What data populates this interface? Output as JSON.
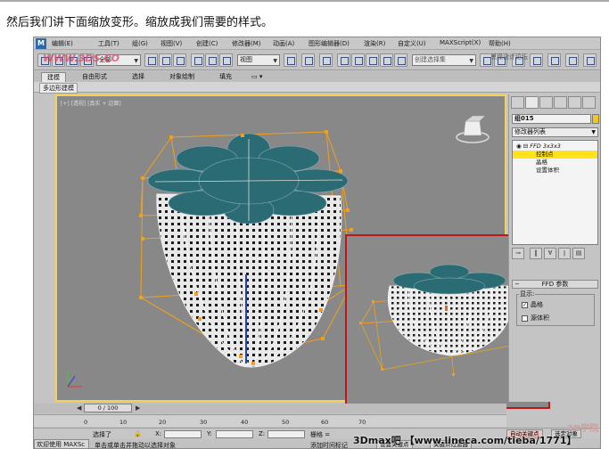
{
  "article": {
    "caption": "然后我们讲下面缩放变形。缩放成我们需要的样式。"
  },
  "menubar": {
    "items": [
      "编辑(E)",
      "工具(T)",
      "组(G)",
      "视图(V)",
      "创建(C)",
      "修改器(M)",
      "动画(A)",
      "图形编辑器(D)",
      "渲染(R)",
      "自定义(U)",
      "MAXScript(X)",
      "帮助(H)"
    ]
  },
  "toolbar": {
    "selection_filter": "全部",
    "reference_coord": "视图",
    "named_selection_placeholder": "创建选择集"
  },
  "watermarks": {
    "top_left": "WWW.3DS.CO",
    "top_right": "思缘设计论坛",
    "bottom": "3Dmax吧 【www.lineca.com/tieba/1771】",
    "brand": "3D学院"
  },
  "ribbon": {
    "tabs": [
      "建模",
      "自由形式",
      "选择",
      "对象绘制",
      "填充"
    ],
    "active_tab": "建模",
    "sub_label": "多边形建模"
  },
  "viewport": {
    "label": "[+] [透视] [真实 + 边面]"
  },
  "command_panel": {
    "object_name": "组015",
    "object_color": "#f3c61a",
    "modifier_list_label": "修改器列表",
    "stack": [
      {
        "label": "FFD 3x3x3",
        "level": 0,
        "selected": false
      },
      {
        "label": "控制点",
        "level": 1,
        "selected": true
      },
      {
        "label": "晶格",
        "level": 1,
        "selected": false
      },
      {
        "label": "设置体积",
        "level": 1,
        "selected": false
      }
    ],
    "rollout_title": "FFD 参数",
    "display_group": "显示:",
    "checkboxes": [
      {
        "label": "晶格",
        "checked": true
      },
      {
        "label": "源体积",
        "checked": false
      }
    ]
  },
  "timeline": {
    "thumb_label": "0 / 100",
    "ticks": [
      "0",
      "10",
      "20",
      "30",
      "40",
      "50",
      "60",
      "70"
    ]
  },
  "status": {
    "selected": "选择了",
    "x_label": "X:",
    "y_label": "Y:",
    "z_label": "Z:",
    "grid": "栅格 =",
    "auto_key": "自动关键点",
    "set_key": "设置关键点",
    "key_filters": "关键点过滤器",
    "selected_obj": "选定对象",
    "welcome": "欢迎使用 MAXSc",
    "prompt": "单击或单击并拖动以选择对象",
    "add_time_tag": "添加时间标记"
  },
  "colors": {
    "viewport_bg": "#888888",
    "active_border": "#f2d25a",
    "lattice": "#f0a01e",
    "cap": "#2a6b74",
    "inset_border": "#c0151b"
  }
}
